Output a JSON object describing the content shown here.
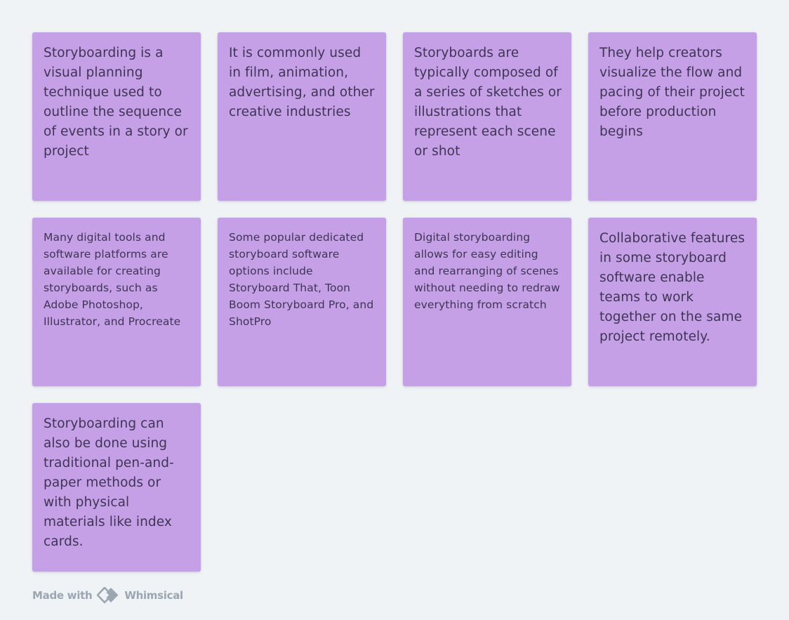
{
  "stickies": [
    {
      "text": "Storyboarding is a visual planning technique used to outline the sequence of events in a story or project",
      "size": "large"
    },
    {
      "text": "It is commonly used in film, animation, advertising, and other creative industries",
      "size": "large"
    },
    {
      "text": "Storyboards are typically composed of a series of sketches or illustrations that represent each scene or shot",
      "size": "large"
    },
    {
      "text": "They help creators visualize the flow and pacing of their project before production begins",
      "size": "large"
    },
    {
      "text": "Many digital tools and software platforms are available for creating storyboards, such as Adobe Photoshop, Illustrator, and Procreate",
      "size": "small"
    },
    {
      "text": "Some popular dedicated storyboard software options include Storyboard That, Toon Boom Storyboard Pro, and ShotPro",
      "size": "small"
    },
    {
      "text": "Digital storyboarding allows for easy editing and rearranging of scenes without needing to redraw everything from scratch",
      "size": "small"
    },
    {
      "text": "Collaborative features in some storyboard software enable teams to work together on the same project remotely.",
      "size": "large"
    },
    {
      "text": "Storyboarding can also be done using traditional pen-and-paper methods or with physical materials like index cards.",
      "size": "large"
    }
  ],
  "colors": {
    "sticky_background": "#c6a0e7",
    "sticky_text": "#3d3553",
    "canvas_background": "#eff3f6",
    "footer_text": "#9ba6b0"
  },
  "footer": {
    "made_with": "Made with",
    "brand": "Whimsical",
    "logo_icon": "whimsical-logo-icon"
  }
}
